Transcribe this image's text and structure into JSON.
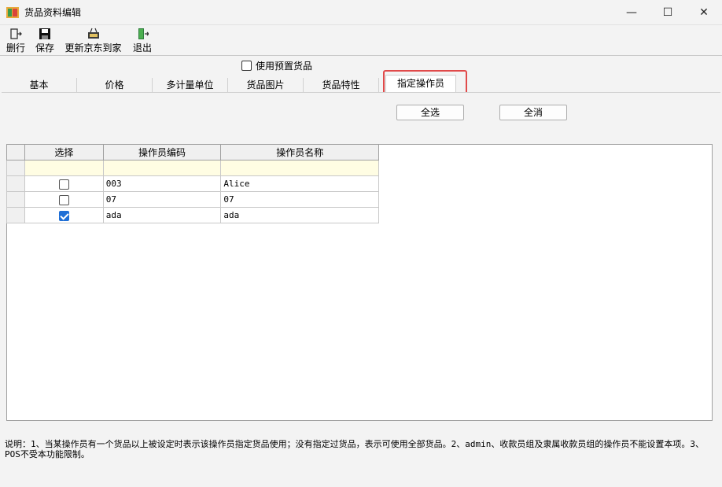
{
  "window": {
    "title": "货品资料编辑",
    "min_glyph": "—",
    "max_glyph": "☐",
    "close_glyph": "✕"
  },
  "toolbar": {
    "delete_row_label": "删行",
    "save_label": "保存",
    "update_jd_label": "更新京东到家",
    "exit_label": "退出"
  },
  "preset": {
    "label": "使用预置货品",
    "checked": false
  },
  "tabs": [
    {
      "label": "基本",
      "active": false
    },
    {
      "label": "价格",
      "active": false
    },
    {
      "label": "多计量单位",
      "active": false
    },
    {
      "label": "货品图片",
      "active": false
    },
    {
      "label": "货品特性",
      "active": false
    },
    {
      "label": "指定操作员",
      "active": true
    }
  ],
  "operators": {
    "select_all_label": "全选",
    "deselect_all_label": "全消",
    "columns": [
      "选择",
      "操作员编码",
      "操作员名称"
    ],
    "rows": [
      {
        "code": "003",
        "name": "Alice",
        "selected": false
      },
      {
        "code": "07",
        "name": "07",
        "selected": false
      },
      {
        "code": "ada",
        "name": "ada",
        "selected": true
      }
    ]
  },
  "note": "说明：1、当某操作员有一个货品以上被设定时表示该操作员指定货品使用；没有指定过货品，表示可使用全部货品。2、admin、收款员组及隶属收款员组的操作员不能设置本项。3、POS不受本功能限制。",
  "colors": {
    "highlight": "#e04a4a",
    "checked": "#1f6fd6",
    "new_row": "#fffde3"
  }
}
